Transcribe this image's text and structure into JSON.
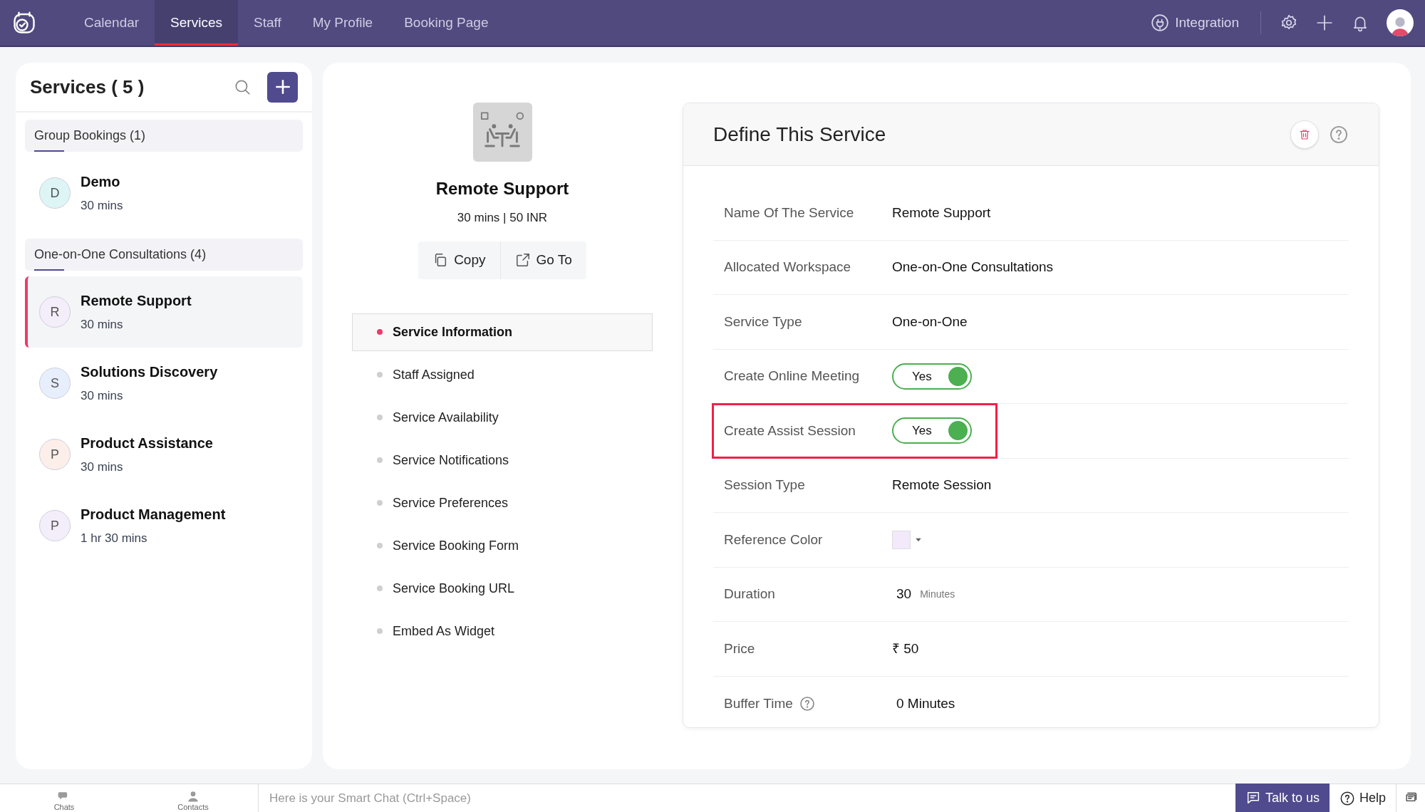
{
  "nav": {
    "tabs": [
      {
        "label": "Calendar",
        "selected": false
      },
      {
        "label": "Services",
        "selected": true
      },
      {
        "label": "Staff",
        "selected": false
      },
      {
        "label": "My Profile",
        "selected": false
      },
      {
        "label": "Booking Page",
        "selected": false
      }
    ],
    "integration": "Integration"
  },
  "services_panel": {
    "title": "Services ( 5 )",
    "groups": [
      {
        "label": "Group Bookings (1)",
        "items": [
          {
            "initial": "D",
            "name": "Demo",
            "duration": "30 mins",
            "color": "#def5f5",
            "selected": false
          }
        ]
      },
      {
        "label": "One-on-One Consultations (4)",
        "items": [
          {
            "initial": "R",
            "name": "Remote Support",
            "duration": "30 mins",
            "color": "#f4eefb",
            "selected": true
          },
          {
            "initial": "S",
            "name": "Solutions Discovery",
            "duration": "30 mins",
            "color": "#e8effc",
            "selected": false
          },
          {
            "initial": "P",
            "name": "Product Assistance",
            "duration": "30 mins",
            "color": "#fcefea",
            "selected": false
          },
          {
            "initial": "P",
            "name": "Product Management",
            "duration": "1 hr 30 mins",
            "color": "#f4eefb",
            "selected": false
          }
        ]
      }
    ]
  },
  "service": {
    "name": "Remote Support",
    "summary": "30 mins | 50 INR",
    "actions": [
      "Copy",
      "Go To"
    ],
    "menu": [
      {
        "label": "Service Information",
        "selected": true
      },
      {
        "label": "Staff Assigned",
        "selected": false
      },
      {
        "label": "Service Availability",
        "selected": false
      },
      {
        "label": "Service Notifications",
        "selected": false
      },
      {
        "label": "Service Preferences",
        "selected": false
      },
      {
        "label": "Service Booking Form",
        "selected": false
      },
      {
        "label": "Service Booking URL",
        "selected": false
      },
      {
        "label": "Embed As Widget",
        "selected": false
      }
    ]
  },
  "details": {
    "title": "Define This Service",
    "rows": [
      {
        "kind": "text",
        "label": "Name Of The Service",
        "value": "Remote Support"
      },
      {
        "kind": "text",
        "label": "Allocated Workspace",
        "value": "One-on-One Consultations"
      },
      {
        "kind": "text",
        "label": "Service Type",
        "value": "One-on-One"
      },
      {
        "kind": "toggle",
        "label": "Create Online Meeting",
        "value": "Yes",
        "on": true,
        "highlighted": false
      },
      {
        "kind": "toggle",
        "label": "Create Assist Session",
        "value": "Yes",
        "on": true,
        "highlighted": true
      },
      {
        "kind": "text",
        "label": "Session Type",
        "value": "Remote Session"
      },
      {
        "kind": "color",
        "label": "Reference Color",
        "color": "#f3e9fb"
      },
      {
        "kind": "duration",
        "label": "Duration",
        "value": "30",
        "unit": "Minutes"
      },
      {
        "kind": "text",
        "label": "Price",
        "value": "₹ 50"
      },
      {
        "kind": "help",
        "label": "Buffer Time",
        "value": "0 Minutes"
      }
    ]
  },
  "bottom_bar": {
    "chats": "Chats",
    "contacts": "Contacts",
    "chat_placeholder": "Here is your Smart Chat (Ctrl+Space)",
    "talk": "Talk to us",
    "help": "Help"
  }
}
